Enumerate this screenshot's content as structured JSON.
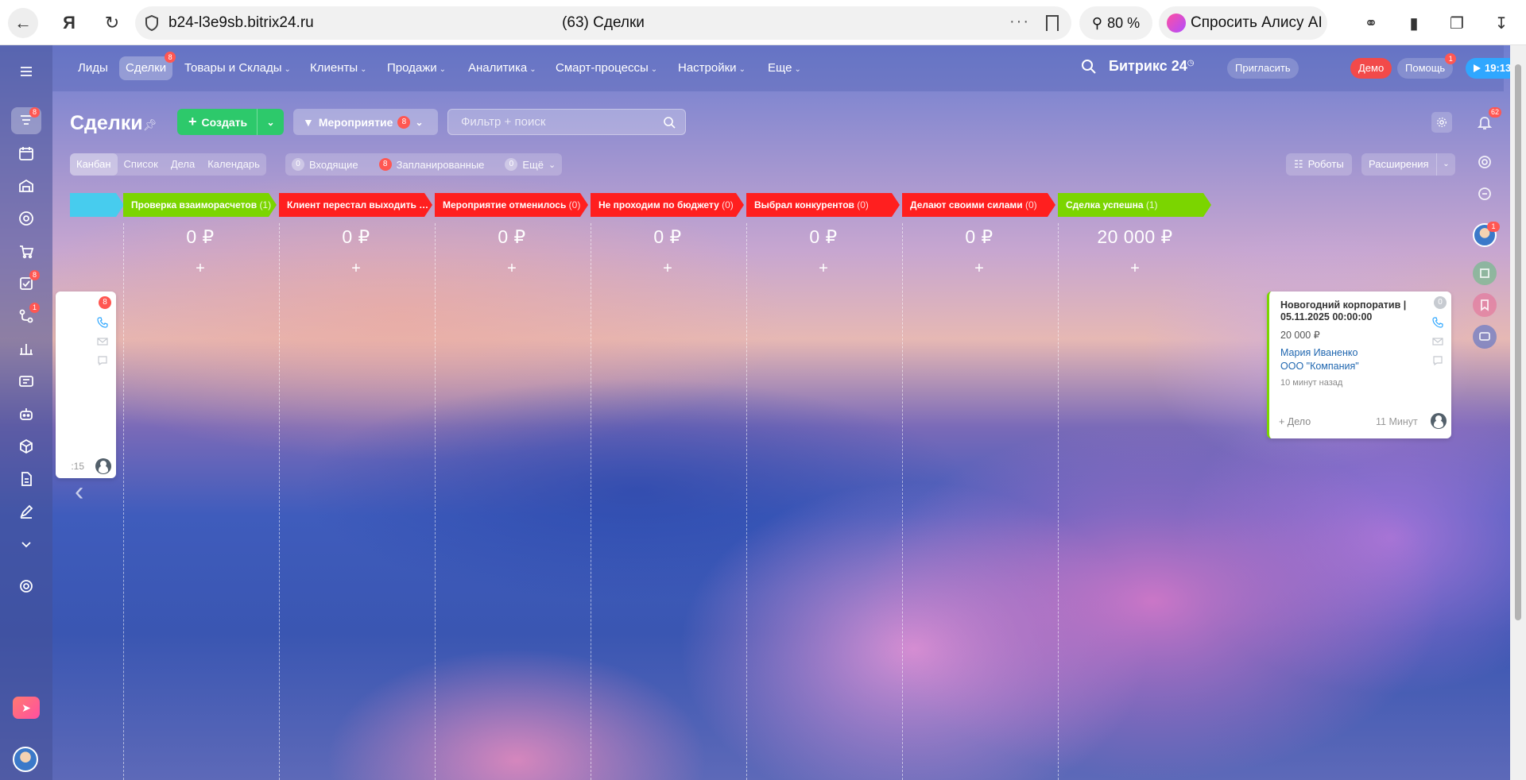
{
  "browser": {
    "url": "b24-l3e9sb.bitrix24.ru",
    "tab_title": "(63) Сделки",
    "zoom": "80 %",
    "alice_label": "Спросить Алису AI",
    "yandex_logo": "Я"
  },
  "top_nav": {
    "items": [
      {
        "label": "Лиды"
      },
      {
        "label": "Сделки",
        "badge": "8"
      },
      {
        "label": "Товары и Склады"
      },
      {
        "label": "Клиенты"
      },
      {
        "label": "Продажи"
      },
      {
        "label": "Аналитика"
      },
      {
        "label": "Смарт-процессы"
      },
      {
        "label": "Настройки"
      },
      {
        "label": "Еще"
      }
    ],
    "brand": "Битрикс",
    "brand_num": "24",
    "invite": "Пригласить",
    "demo": "Демо",
    "help": "Помощь",
    "help_badge": "1",
    "timer": "19:13"
  },
  "left_nav": {
    "badges": {
      "crm": "8",
      "tasks": "8",
      "automation": "1"
    }
  },
  "right_bar": {
    "notifications_badge": "62",
    "avatar_badge": "1"
  },
  "toolbar": {
    "title": "Сделки",
    "create_label": "Создать",
    "funnel_label": "Мероприятие",
    "funnel_badge": "8",
    "filter_placeholder": "Фильтр + поиск",
    "robots_label": "Роботы",
    "extensions_label": "Расширения"
  },
  "views": {
    "tabs": [
      "Канбан",
      "Список",
      "Дела",
      "Календарь"
    ],
    "counters": [
      {
        "count": "0",
        "label": "Входящие"
      },
      {
        "count": "8",
        "label": "Запланированные"
      },
      {
        "count": "0",
        "label": "Ещё"
      }
    ]
  },
  "stages": [
    {
      "name": "Проверка взаиморасчетов",
      "count": "(1)",
      "total": "0 ₽",
      "color": "#7bd500"
    },
    {
      "name": "Клиент перестал выходить на с...",
      "count": "(0)",
      "total": "0 ₽",
      "color": "#ff1f1f"
    },
    {
      "name": "Мероприятие отменилось",
      "count": "(0)",
      "total": "0 ₽",
      "color": "#ff1f1f"
    },
    {
      "name": "Не проходим по бюджету",
      "count": "(0)",
      "total": "0 ₽",
      "color": "#ff1f1f"
    },
    {
      "name": "Выбрал конкурентов",
      "count": "(0)",
      "total": "0 ₽",
      "color": "#ff1f1f"
    },
    {
      "name": "Делают своими силами",
      "count": "(0)",
      "total": "0 ₽",
      "color": "#ff1f1f"
    },
    {
      "name": "Сделка успешна",
      "count": "(1)",
      "total": "20 000 ₽",
      "color": "#7bd500"
    }
  ],
  "first_stage_color": "#47ccee",
  "card_main": {
    "title": "Новогодний корпоратив | 05.11.2025 00:00:00",
    "sum": "20 000 ₽",
    "contact": "Мария Иваненко",
    "company": "ООО \"Компания\"",
    "time": "10 минут назад",
    "add_task": "+ Дело",
    "duration": "11 Минут",
    "counter": "0"
  },
  "card_left": {
    "counter": "8",
    "clock": ":15"
  }
}
